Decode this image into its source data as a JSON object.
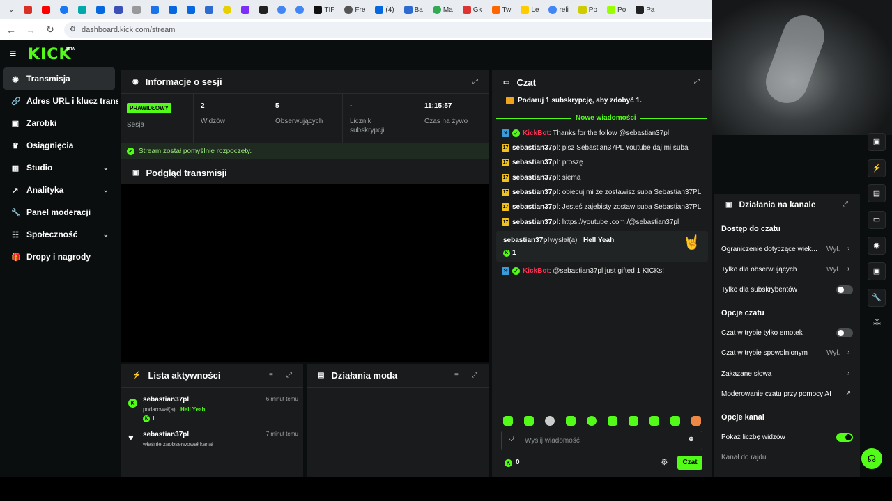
{
  "browser": {
    "tabs": [
      "TIF",
      "Fre",
      "(4)",
      "Ba",
      "Ma",
      "Gk",
      "Tw",
      "Le",
      "reli",
      "Po",
      "Po",
      "Pa"
    ],
    "url": "dashboard.kick.com/stream"
  },
  "logo": {
    "text": "KICK",
    "beta": "BETA"
  },
  "sidebar": {
    "items": [
      {
        "label": "Transmisja",
        "icon": "radio-icon"
      },
      {
        "label": "Adres URL i klucz transmisji",
        "icon": "link-icon"
      },
      {
        "label": "Zarobki",
        "icon": "wallet-icon"
      },
      {
        "label": "Osiągnięcia",
        "icon": "trophy-icon"
      },
      {
        "label": "Studio",
        "icon": "studio-icon"
      },
      {
        "label": "Analityka",
        "icon": "chart-icon"
      },
      {
        "label": "Panel moderacji",
        "icon": "wrench-icon"
      },
      {
        "label": "Społeczność",
        "icon": "community-icon"
      },
      {
        "label": "Dropy i nagrody",
        "icon": "gift-icon"
      }
    ]
  },
  "session": {
    "title": "Informacje o sesji",
    "status_badge": "PRAWIDŁOWY",
    "session_label": "Sesja",
    "stats": [
      {
        "value": "2",
        "label": "Widzów"
      },
      {
        "value": "5",
        "label": "Obserwujących"
      },
      {
        "value": "-",
        "label": "Licznik subskrypcji"
      },
      {
        "value": "11:15:57",
        "label": "Czas na żywo"
      }
    ],
    "success_msg": "Stream został pomyślnie rozpoczęty."
  },
  "preview": {
    "title": "Podgląd transmisji"
  },
  "activity": {
    "title": "Lista aktywności",
    "items": [
      {
        "user": "sebastian37pl",
        "time": "6 minut temu",
        "line1": "podarował(a)",
        "highlight": "Hell Yeah",
        "count": "1"
      },
      {
        "user": "sebastian37pl",
        "time": "7 minut temu",
        "line1": "właśnie zaobserwował kanał"
      }
    ]
  },
  "mod": {
    "title": "Działania moda"
  },
  "chat": {
    "title": "Czat",
    "pinned": "Podaruj 1 subskrypcję, aby zdobyć 1.",
    "new_msgs": "Nowe wiadomości",
    "messages": [
      {
        "user": "KickBot",
        "text": ": Thanks for the follow @sebastian37pl"
      },
      {
        "user": "sebastian37pl",
        "text": ": pisz Sebastian37PL Youtube daj mi suba"
      },
      {
        "user": "sebastian37pl",
        "text": ": proszę"
      },
      {
        "user": "sebastian37pl",
        "text": ": siema"
      },
      {
        "user": "sebastian37pl",
        "text": ": obiecuj mi że zostawisz suba Sebastian37PL"
      },
      {
        "user": "sebastian37pl",
        "text": ": Jesteś zajebisty zostaw suba Sebastian37PL"
      },
      {
        "user": "sebastian37pl",
        "text": ": https://youtube .com /@sebastian37pl"
      }
    ],
    "gift": {
      "user": "sebastian37pl",
      "verb": "wysłał(a)",
      "item": "Hell Yeah",
      "count": "1"
    },
    "last": {
      "user": "KickBot",
      "text": ": @sebastian37pl just gifted 1 KICKs!"
    },
    "input_placeholder": "Wyślij wiadomość",
    "balance": "0",
    "send_label": "Czat"
  },
  "channel": {
    "title": "Działania na kanale",
    "sec1": "Dostęp do czatu",
    "row_restrict": "Ograniczenie dotyczące wiek...",
    "row_followers": "Tylko dla obserwujących",
    "row_subs": "Tylko dla subskrybentów",
    "sec2": "Opcje czatu",
    "row_emotes": "Czat w trybie tylko emotek",
    "row_slow": "Czat w trybie spowolnionym",
    "row_banned": "Zakazane słowa",
    "row_ai": "Moderowanie czatu przy pomocy AI",
    "sec3": "Opcje kanał",
    "row_viewers": "Pokaż liczbę widzów",
    "row_raid": "Kanał do rajdu",
    "off_label": "Wył."
  },
  "colors": {
    "accent": "#53fc18",
    "kickbot": "#ff3355",
    "panel": "#191b1c"
  }
}
